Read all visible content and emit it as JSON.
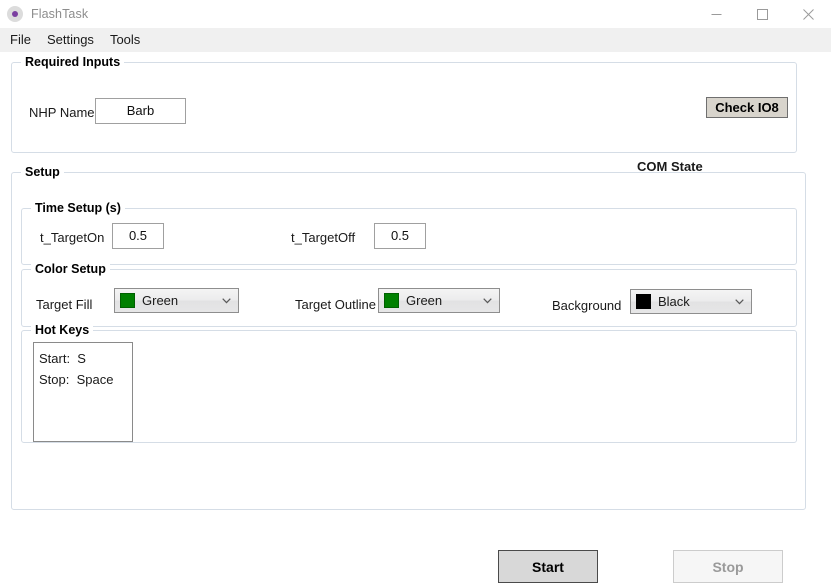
{
  "window": {
    "title": "FlashTask",
    "icon": "app-circle-icon",
    "controls": {
      "minimize": "minimize-icon",
      "maximize": "maximize-icon",
      "close": "close-icon"
    }
  },
  "menubar": {
    "items": [
      {
        "label": "File"
      },
      {
        "label": "Settings"
      },
      {
        "label": "Tools"
      }
    ]
  },
  "required_inputs": {
    "legend": "Required Inputs",
    "nhp_name": {
      "label": "NHP Name",
      "value": "Barb",
      "placeholder": ""
    },
    "com_state": {
      "label": "COM State",
      "button_label": "Check IO8"
    }
  },
  "setup": {
    "legend": "Setup",
    "time_setup": {
      "legend": "Time Setup (s)",
      "fields": [
        {
          "label": "t_TargetOn",
          "value": "0.5"
        },
        {
          "label": "t_TargetOff",
          "value": "0.5"
        }
      ]
    },
    "color_setup": {
      "legend": "Color Setup",
      "fields": [
        {
          "label": "Target Fill",
          "value": "Green",
          "swatch": "#008000"
        },
        {
          "label": "Target Outline",
          "value": "Green",
          "swatch": "#008000"
        },
        {
          "label": "Background",
          "value": "Black",
          "swatch": "#000000"
        }
      ]
    },
    "hot_keys": {
      "legend": "Hot Keys",
      "rows": [
        "Start:  S",
        "Stop:  Space"
      ]
    }
  },
  "actions": {
    "start": {
      "label": "Start",
      "enabled": true
    },
    "stop": {
      "label": "Stop",
      "enabled": false
    }
  }
}
